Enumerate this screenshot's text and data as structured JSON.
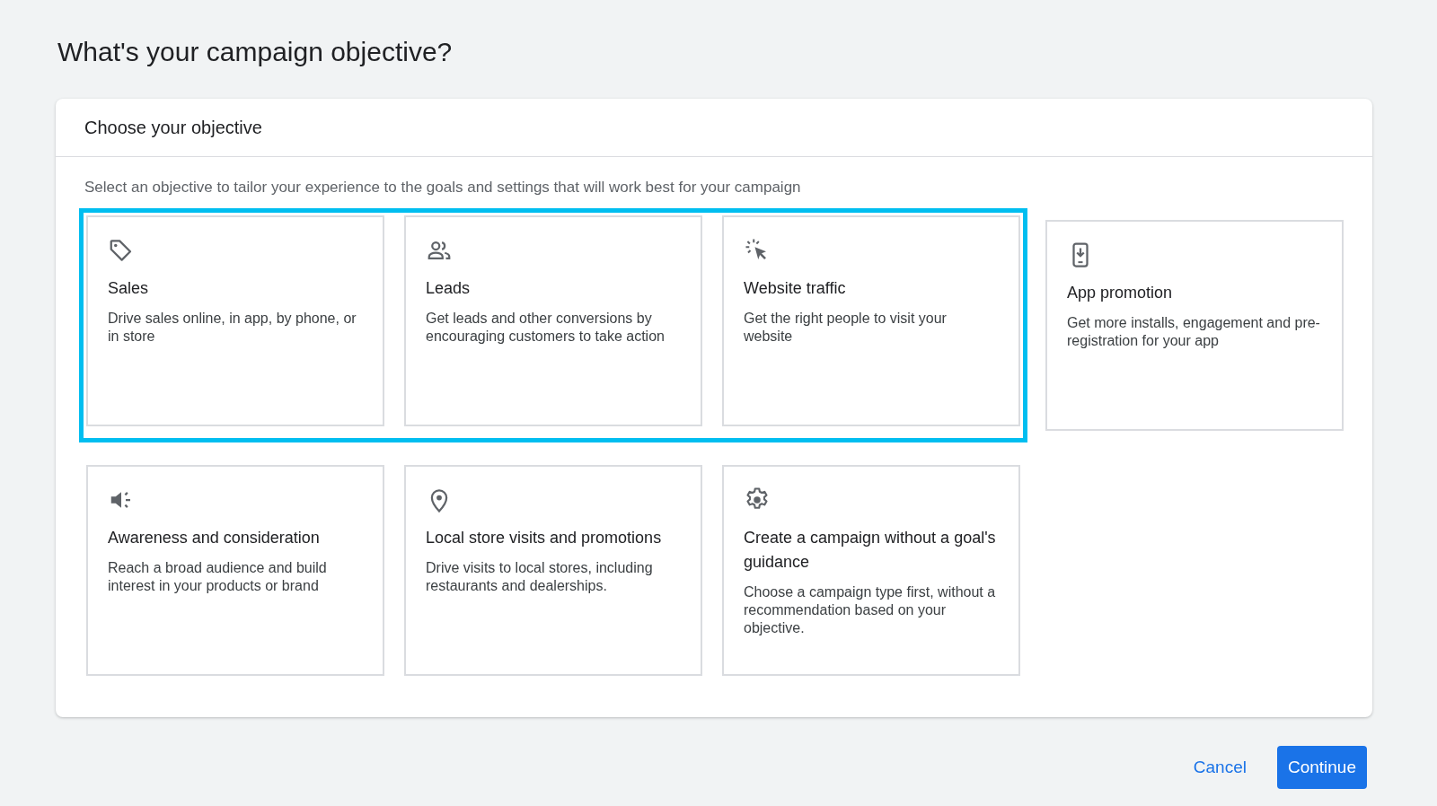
{
  "page_title": "What's your campaign objective?",
  "panel": {
    "title": "Choose your objective",
    "description": "Select an objective to tailor your experience to the goals and settings that will work best for your campaign",
    "rows": [
      {
        "groups": [
          {
            "highlighted": true,
            "cards": [
              {
                "title": "Sales",
                "description": "Drive sales online, in app, by phone, or in store"
              },
              {
                "title": "Leads",
                "description": "Get leads and other conversions by encouraging customers to take action"
              },
              {
                "title": "Website traffic",
                "description": "Get the right people to visit your website"
              }
            ]
          },
          {
            "highlighted": false,
            "cards": [
              {
                "title": "App promotion",
                "description": "Get more installs, engagement and pre-registration for your app"
              }
            ]
          }
        ]
      },
      {
        "groups": [
          {
            "highlighted": false,
            "cards": [
              {
                "title": "Awareness and consideration",
                "description": "Reach a broad audience and build interest in your products or brand"
              },
              {
                "title": "Local store visits and promotions",
                "description": "Drive visits to local stores, including restaurants and dealerships."
              },
              {
                "title": "Create a campaign without a goal's guidance",
                "description": "Choose a campaign type first, without a recommendation based on your objective."
              }
            ]
          }
        ]
      }
    ]
  },
  "buttons": {
    "cancel": "Cancel",
    "continue": "Continue"
  }
}
